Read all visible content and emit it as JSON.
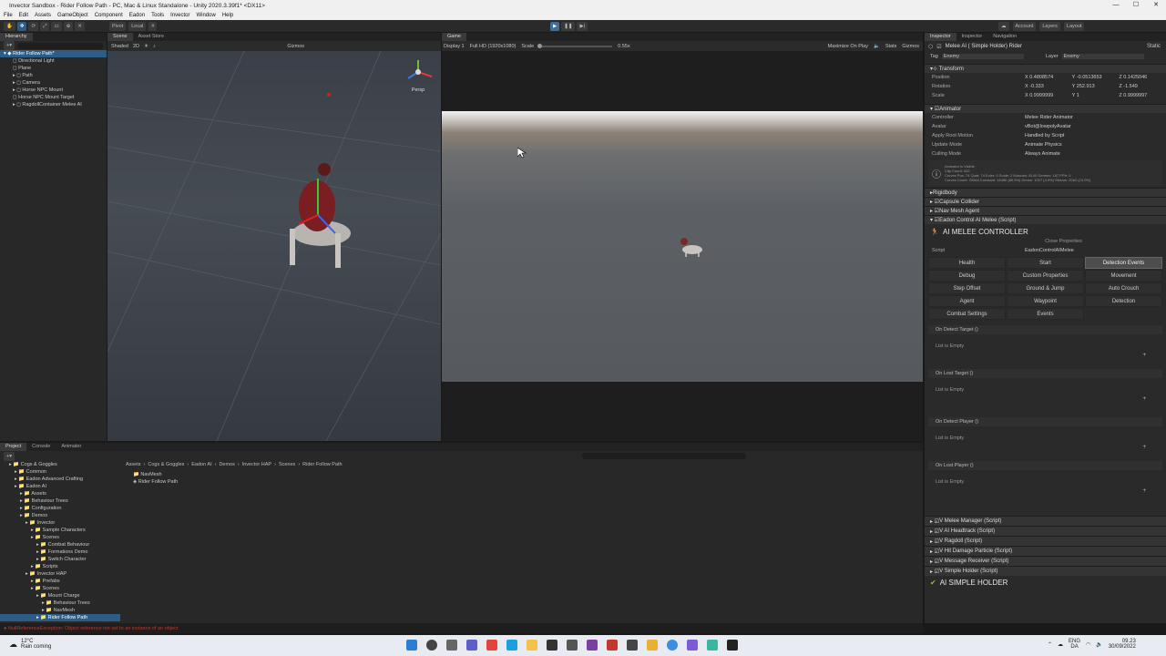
{
  "window": {
    "title": "Invector Sandbox - Rider Follow Path - PC, Mac & Linux Standalone - Unity 2020.3.39f1* <DX11>",
    "controls": [
      "—",
      "☐",
      "✕"
    ]
  },
  "menu": [
    "File",
    "Edit",
    "Assets",
    "GameObject",
    "Component",
    "Eadon",
    "Tools",
    "Invector",
    "Window",
    "Help"
  ],
  "toolbar": {
    "pivot": "Pivot",
    "local": "Local",
    "account": "Account",
    "layers": "Layers",
    "layout": "Layout"
  },
  "hierarchy": {
    "tab": "Hierarchy",
    "root": "Rider Follow Path*",
    "items": [
      "Directional Light",
      "Plane",
      "Path",
      "Camera",
      "Horse NPC Mount",
      "Horse NPC Mount Target",
      "RagdollContainer Melee AI"
    ]
  },
  "scene": {
    "tabs": [
      "Scene",
      "Asset Store"
    ],
    "shading": "Shaded",
    "mode2d": "2D",
    "gizmos": "Gizmos",
    "persp": "Persp"
  },
  "game": {
    "tab": "Game",
    "display": "Display 1",
    "resolution": "Full HD (1920x1080)",
    "scale_label": "Scale",
    "scale_value": "0.55x",
    "maximize": "Maximize On Play",
    "stats": "Stats",
    "gizmos": "Gizmos"
  },
  "inspector": {
    "tabs": [
      "Inspector",
      "Inspector",
      "Navigation"
    ],
    "object_name": "Melee AI ( Simple Holder) Rider",
    "static": "Static",
    "tag_label": "Tag",
    "tag": "Enemy",
    "layer_label": "Layer",
    "layer": "Enemy",
    "transform": {
      "title": "Transform",
      "position_label": "Position",
      "rotation_label": "Rotation",
      "scale_label": "Scale",
      "position": [
        "0.4808574",
        "-0.0513653",
        "0.1425046"
      ],
      "rotation": [
        "-0.333",
        "252.913",
        "-1.549"
      ],
      "scale": [
        "0.9999999",
        "1",
        "0.9999997"
      ]
    },
    "animator": {
      "title": "Animator",
      "rows": [
        {
          "label": "Controller",
          "value": "Melee Rider Animator"
        },
        {
          "label": "Avatar",
          "value": "vBot@lowpolyAvatar"
        },
        {
          "label": "Apply Root Motion",
          "value": "Handled by Script"
        },
        {
          "label": "Update Mode",
          "value": "Animate Physics"
        },
        {
          "label": "Culling Mode",
          "value": "Always Animate"
        }
      ],
      "info": [
        "Animator is Visible",
        "Clip Count: 422",
        "Curves Pos: 74 Quat: 74 Euler: 0 Scale: 2 Muscles: 8140 Generic: 187 PPtr: 0",
        "Curves Count: 20564 Constant: 18480 (89.9%) Dense: 1027 (4.9%) Stream: 2062 (10.0%)"
      ]
    },
    "components": [
      "Rigidbody",
      "Capsule Collider",
      "Nav Mesh Agent",
      "Eadon Control AI Melee (Script)"
    ],
    "ai_controller": {
      "title": "AI MELEE CONTROLLER",
      "close": "Close Properties",
      "script_label": "Script",
      "script_value": "EadonControlAIMelee",
      "buttons": [
        "Health",
        "Start",
        "Detection Events",
        "Debug",
        "Custom Properties",
        "Movement",
        "Step Offset",
        "Ground & Jump",
        "Auto Crouch",
        "Agent",
        "Waypoint",
        "Detection",
        "Combat Settings",
        "Events"
      ],
      "active_button": "Detection Events"
    },
    "events": [
      {
        "name": "On Detect Target ()",
        "empty": "List is Empty"
      },
      {
        "name": "On Lost Target ()",
        "empty": "List is Empty"
      },
      {
        "name": "On Detect Player ()",
        "empty": "List is Empty"
      },
      {
        "name": "On Lost Player ()",
        "empty": "List is Empty"
      }
    ],
    "scripts": [
      "V Melee Manager (Script)",
      "V AI Headtrack (Script)",
      "V Ragdoll (Script)",
      "V Hit Damage Particle (Script)",
      "V Message Receiver (Script)",
      "V Simple Holder (Script)"
    ],
    "holder_title": "AI SIMPLE HOLDER"
  },
  "project": {
    "tabs": [
      "Project",
      "Console",
      "Animator"
    ],
    "breadcrumb": [
      "Assets",
      "Cogs & Goggles",
      "Eadon AI",
      "Demos",
      "Invector HAP",
      "Scenes",
      "Rider Follow Path"
    ],
    "files": [
      "NavMesh",
      "Rider Follow Path"
    ],
    "tree": [
      {
        "t": "Cogs & Goggles",
        "d": 1
      },
      {
        "t": "Common",
        "d": 2
      },
      {
        "t": "Eadon Advanced Crafting",
        "d": 2
      },
      {
        "t": "Eadon AI",
        "d": 2
      },
      {
        "t": "Assets",
        "d": 3
      },
      {
        "t": "Behaviour Trees",
        "d": 3
      },
      {
        "t": "Configuration",
        "d": 3
      },
      {
        "t": "Demos",
        "d": 3
      },
      {
        "t": "Invector",
        "d": 4
      },
      {
        "t": "Sample Characters",
        "d": 5
      },
      {
        "t": "Scenes",
        "d": 5
      },
      {
        "t": "Combat Behaviour",
        "d": 6
      },
      {
        "t": "Formations Demo",
        "d": 6
      },
      {
        "t": "Switch Character",
        "d": 6
      },
      {
        "t": "Scripts",
        "d": 5
      },
      {
        "t": "Invector HAP",
        "d": 4
      },
      {
        "t": "Prefabs",
        "d": 5
      },
      {
        "t": "Scenes",
        "d": 5
      },
      {
        "t": "Mount Charge",
        "d": 6
      },
      {
        "t": "Behaviour Trees",
        "d": 7
      },
      {
        "t": "NavMesh",
        "d": 7
      },
      {
        "t": "Rider Follow Path",
        "d": 6
      }
    ]
  },
  "status": {
    "error": "NullReferenceException: Object reference not set to an instance of an object"
  },
  "taskbar": {
    "temp": "12°C",
    "weather": "Rain coming",
    "lang1": "ENG",
    "lang2": "DA",
    "time": "09.23",
    "date": "30/09/2022"
  }
}
